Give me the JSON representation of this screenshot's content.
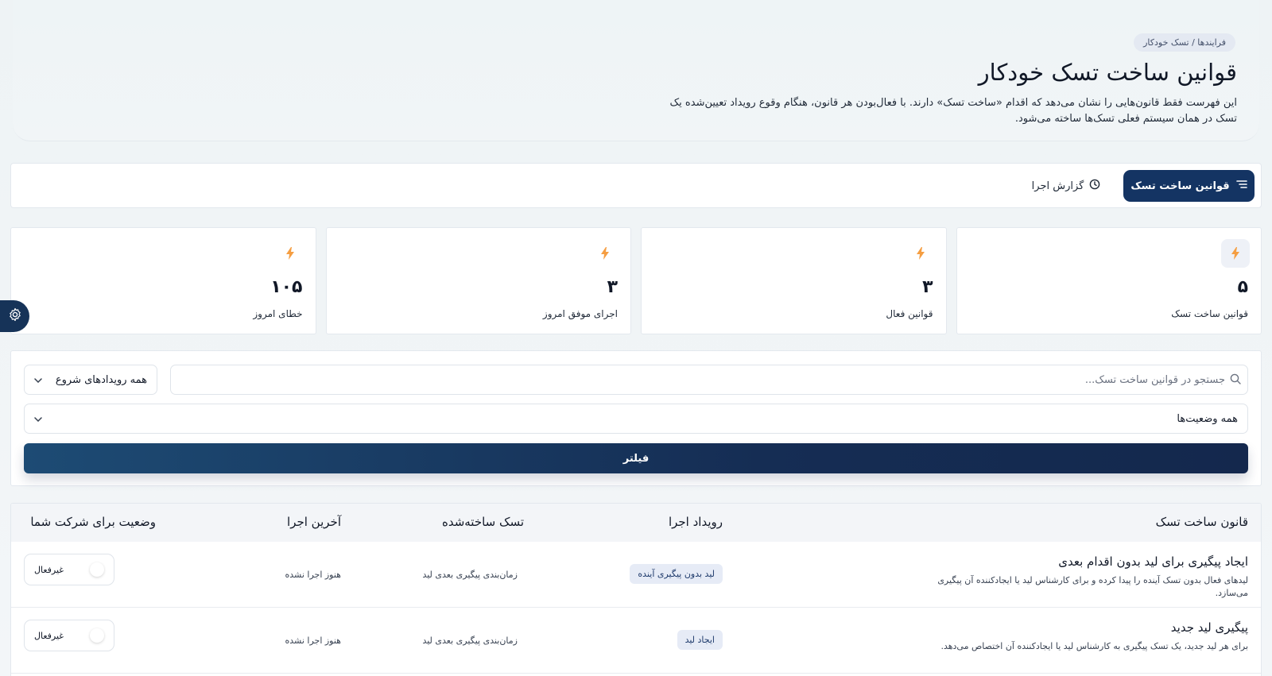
{
  "breadcrumb": "فرایندها / تسک خودکار",
  "page": {
    "title": "قوانین ساخت تسک خودکار",
    "description": "این فهرست فقط قانون‌هایی را نشان می‌دهد که اقدام «ساخت تسک» دارند. با فعال‌بودن هر قانون، هنگام وقوع رویداد تعیین‌شده یک تسک در همان سیستم فعلی تسک‌ها ساخته می‌شود."
  },
  "tabs": [
    {
      "label": "قوانین ساخت تسک",
      "icon": "list-icon",
      "active": true
    },
    {
      "label": "گزارش اجرا",
      "icon": "clock-icon",
      "active": false
    }
  ],
  "stats": [
    {
      "value": "۵",
      "label": "قوانین ساخت تسک",
      "icon": "bolt-icon"
    },
    {
      "value": "۳",
      "label": "قوانین فعال",
      "icon": "bolt-icon"
    },
    {
      "value": "۳",
      "label": "اجرای موفق امروز",
      "icon": "bolt-icon"
    },
    {
      "value": "۱۰۵",
      "label": "خطای امروز",
      "icon": "bolt-icon"
    }
  ],
  "filters": {
    "search_placeholder": "جستجو در قوانین ساخت تسک...",
    "events_select": "همه رویدادهای شروع",
    "status_select": "همه وضعیت‌ها",
    "filter_button": "فیلتر"
  },
  "table": {
    "headers": [
      "قانون ساخت تسک",
      "رویداد اجرا",
      "تسک ساخته‌شده",
      "آخرین اجرا",
      "وضعیت برای شرکت شما"
    ],
    "rows": [
      {
        "title": "ایجاد پیگیری برای لید بدون اقدام بعدی",
        "description": "لیدهای فعال بدون تسک آینده را پیدا کرده و برای کارشناس لید یا ایجادکننده آن پیگیری می‌سازد.",
        "event": "لید بدون پیگیری آینده",
        "created_task": "زمان‌بندی پیگیری بعدی لید",
        "last_run": "هنوز اجرا نشده",
        "status": "غیرفعال"
      },
      {
        "title": "پیگیری لید جدید",
        "description": "برای هر لید جدید، یک تسک پیگیری به کارشناس لید یا ایجادکننده آن اختصاص می‌دهد.",
        "event": "ایجاد لید",
        "created_task": "زمان‌بندی پیگیری بعدی لید",
        "last_run": "هنوز اجرا نشده",
        "status": "غیرفعال"
      }
    ]
  },
  "colors": {
    "primary": "#143463",
    "accent_bolt": "#f59e42",
    "badge_bg": "#e6ebf6"
  }
}
